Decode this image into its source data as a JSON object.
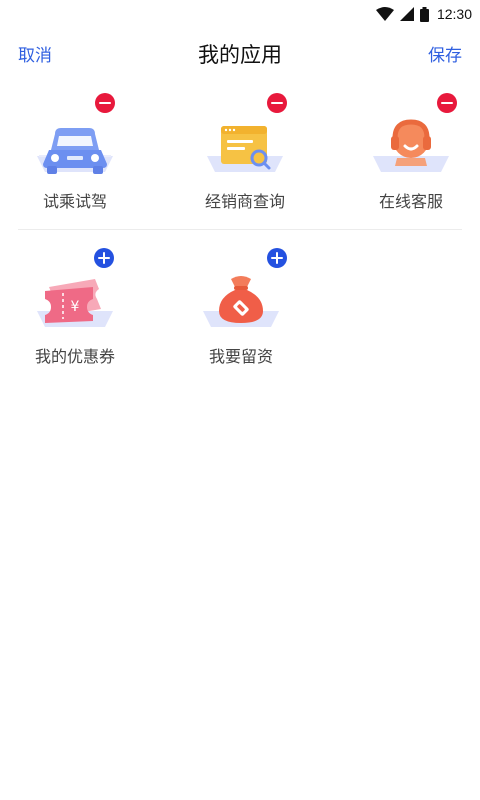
{
  "status_bar": {
    "time": "12:30",
    "icons": [
      "wifi-icon",
      "cellular-signal-icon",
      "battery-icon"
    ]
  },
  "nav": {
    "cancel_label": "取消",
    "title": "我的应用",
    "save_label": "保存"
  },
  "my_apps": [
    {
      "label": "试乘试驾",
      "icon": "car-icon",
      "action": "remove"
    },
    {
      "label": "经销商查询",
      "icon": "dealer-search-icon",
      "action": "remove"
    },
    {
      "label": "在线客服",
      "icon": "customer-service-icon",
      "action": "remove"
    }
  ],
  "more_apps": [
    {
      "label": "我的优惠券",
      "icon": "coupon-icon",
      "action": "add"
    },
    {
      "label": "我要留资",
      "icon": "money-bag-icon",
      "action": "add"
    }
  ],
  "colors": {
    "accent_blue": "#2f5fe0",
    "remove_red": "#e8193c",
    "add_blue": "#2451e0"
  }
}
